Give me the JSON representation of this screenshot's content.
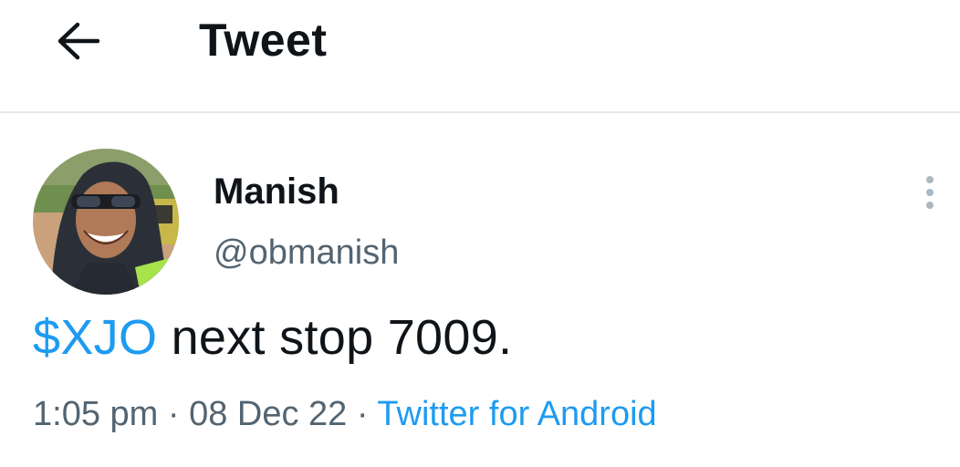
{
  "header": {
    "title": "Tweet",
    "back_icon": "arrow-left-icon"
  },
  "tweet": {
    "author": {
      "name": "Manish",
      "handle": "@obmanish"
    },
    "more_icon": "more-vertical-icon",
    "text": {
      "cashtag": "$XJO",
      "body": " next stop 7009."
    },
    "time": "1:05 pm",
    "separator": " · ",
    "date": "08 Dec 22",
    "source": "Twitter for Android"
  },
  "colors": {
    "accent": "#1d9bf0",
    "text_primary": "#0f1419",
    "text_secondary": "#536471",
    "divider": "#e6e9ec"
  }
}
